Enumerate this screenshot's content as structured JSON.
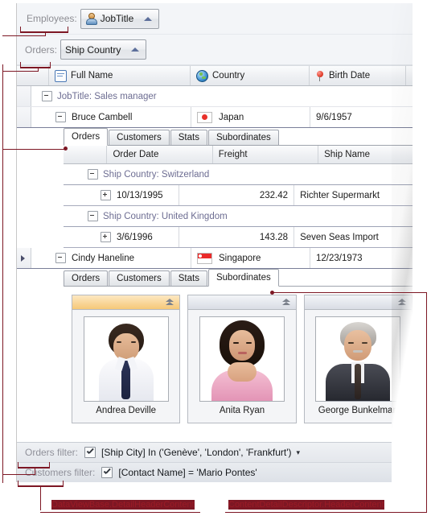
{
  "toolbar": {
    "employees_label": "Employees:",
    "employees_value": "JobTitle",
    "orders_label": "Orders:",
    "orders_value": "Ship Country"
  },
  "master_grid": {
    "columns": [
      {
        "label": "Full Name",
        "icon": "card-icon"
      },
      {
        "label": "Country",
        "icon": "globe-icon"
      },
      {
        "label": "Birth Date",
        "icon": "pin-icon"
      }
    ],
    "group_row": "JobTitle: Sales manager",
    "rows": [
      {
        "name": "Bruce Cambell",
        "country": "Japan",
        "flag": "japan-flag",
        "birth_date": "9/6/1957"
      },
      {
        "name": "Cindy Haneline",
        "country": "Singapore",
        "flag": "singapore-flag",
        "birth_date": "12/23/1973"
      }
    ]
  },
  "detail_tabs_1": {
    "tabs": [
      "Orders",
      "Customers",
      "Stats",
      "Subordinates"
    ],
    "active": "Orders"
  },
  "orders_grid": {
    "columns": [
      "Order Date",
      "Freight",
      "Ship Name"
    ],
    "groups": [
      {
        "header": "Ship Country: Switzerland",
        "rows": [
          {
            "order_date": "10/13/1995",
            "freight": "232.42",
            "ship_name": "Richter Supermarkt"
          }
        ]
      },
      {
        "header": "Ship Country: United Kingdom",
        "rows": [
          {
            "order_date": "3/6/1996",
            "freight": "143.28",
            "ship_name": "Seven Seas Import"
          }
        ]
      }
    ]
  },
  "detail_tabs_2": {
    "tabs": [
      "Orders",
      "Customers",
      "Stats",
      "Subordinates"
    ],
    "active": "Subordinates"
  },
  "subordinates": {
    "cards": [
      {
        "name": "Andrea Deville",
        "selected": true
      },
      {
        "name": "Anita Ryan",
        "selected": false
      },
      {
        "name": "George Bunkelman",
        "selected": false
      }
    ]
  },
  "filters": [
    {
      "label": "Orders filter:",
      "expression": "[Ship City] In ('Genève', 'London', 'Frankfurt')",
      "checked": true,
      "has_caret": true
    },
    {
      "label": "Customers filter:",
      "expression": "[Contact Name] = 'Mario Pontes'",
      "checked": true,
      "has_caret": false
    }
  ],
  "annotations": {
    "left_label": "DataViewBase.DetailHeaderContent",
    "right_label": "ContentDetailDescriptor.HeaderContent",
    "accent_color": "#7d1724",
    "label_color": "#9b1b26"
  }
}
